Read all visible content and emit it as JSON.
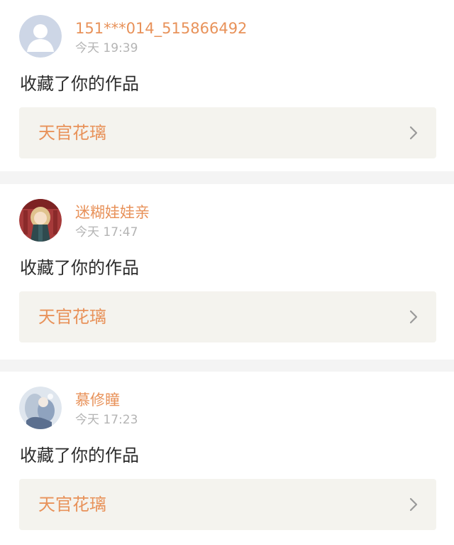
{
  "notifications": [
    {
      "username": "151***014_515866492",
      "time": "今天 19:39",
      "action": "收藏了你的作品",
      "work_title": "天官花璃",
      "avatar_icon": "default-user-avatar"
    },
    {
      "username": "迷糊娃娃亲",
      "time": "今天 17:47",
      "action": "收藏了你的作品",
      "work_title": "天官花璃",
      "avatar_icon": "anime-girl-avatar"
    },
    {
      "username": "慕修瞳",
      "time": "今天 17:23",
      "action": "收藏了你的作品",
      "work_title": "天官花璃",
      "avatar_icon": "fantasy-art-avatar"
    }
  ],
  "colors": {
    "accent": "#e8925a",
    "time": "#b4b4b4",
    "text": "#2b2b2b",
    "link_bg": "#f4f3ee",
    "page_bg": "#f4f4f4"
  }
}
